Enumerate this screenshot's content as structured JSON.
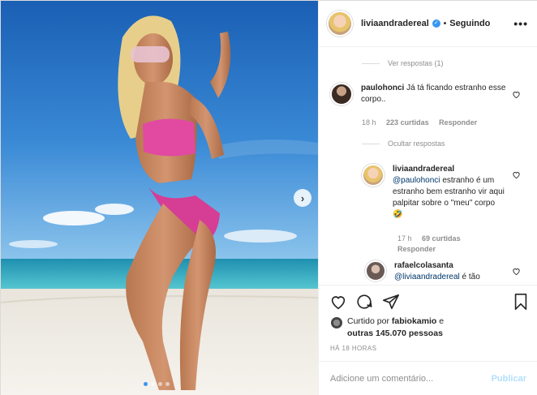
{
  "post": {
    "username": "liviaandradereal",
    "separator": "•",
    "follow_status": "Seguindo",
    "more_icon": "more-horizontal-icon"
  },
  "comments": {
    "view_replies": "Ver respostas (1)",
    "c1": {
      "user": "paulohonci",
      "text": "Já tá ficando estranho esse corpo..",
      "age": "18 h",
      "likes": "223 curtidas",
      "reply": "Responder"
    },
    "hide_replies": "Ocultar respostas",
    "c2": {
      "user": "liviaandradereal",
      "mention": "@paulohonci",
      "text": "estranho é um estranho bem estranho vir aqui palpitar sobre o \"meu\" corpo 🤣",
      "age": "17 h",
      "likes": "69 curtidas",
      "reply": "Responder"
    },
    "c3": {
      "user": "rafaelcolasanta",
      "mention": "@liviaandradereal",
      "text": "é tão"
    }
  },
  "likes": {
    "prefix": "Curtido por",
    "user": "fabiokamio",
    "connector": "e",
    "others": "outras 145.070 pessoas"
  },
  "timestamp": "HÁ 18 HORAS",
  "add_comment": {
    "placeholder": "Adicione um comentário...",
    "publish": "Publicar"
  },
  "carousel": {
    "slides": 4,
    "current": 1
  },
  "colors": {
    "accent": "#3897f0",
    "muted": "#8e8e8e",
    "publish_disabled": "#b2dffc"
  }
}
